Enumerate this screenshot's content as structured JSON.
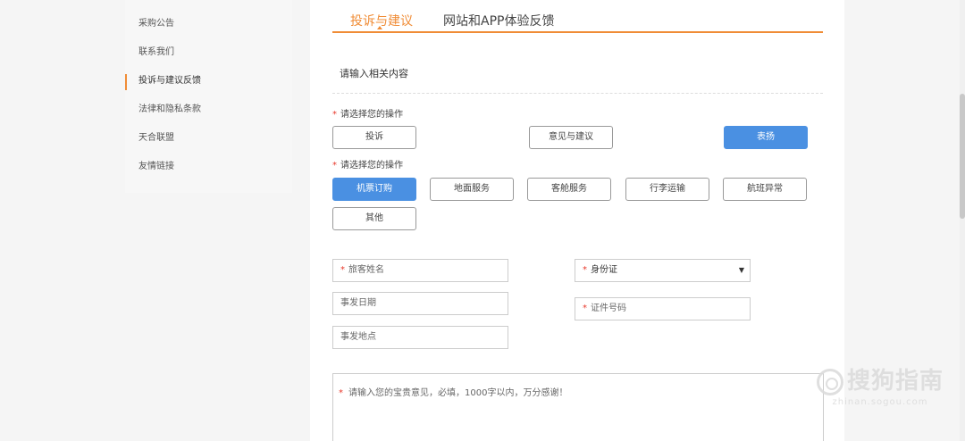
{
  "sidebar": {
    "items": [
      {
        "label": "采购公告"
      },
      {
        "label": "联系我们"
      },
      {
        "label": "投诉与建议反馈"
      },
      {
        "label": "法律和隐私条款"
      },
      {
        "label": "天合联盟"
      },
      {
        "label": "友情链接"
      }
    ],
    "active_index": 2
  },
  "tabs": [
    {
      "label": "投诉与建议"
    },
    {
      "label": "网站和APP体验反馈"
    }
  ],
  "form": {
    "section_title": "请输入相关内容",
    "required_mark": "*",
    "op_label_1": "请选择您的操作",
    "op_buttons_1": [
      {
        "label": "投诉"
      },
      {
        "label": "意见与建议"
      },
      {
        "label": "表扬"
      }
    ],
    "op_label_2": "请选择您的操作",
    "op_buttons_2": [
      {
        "label": "机票订购"
      },
      {
        "label": "地面服务"
      },
      {
        "label": "客舱服务"
      },
      {
        "label": "行李运输"
      },
      {
        "label": "航班异常"
      },
      {
        "label": "其他"
      }
    ],
    "passenger_name_placeholder": "旅客姓名",
    "id_type_selected": "身份证",
    "event_date_placeholder": "事发日期",
    "id_number_placeholder": "证件号码",
    "event_place_placeholder": "事发地点",
    "comment_placeholder": "请输入您的宝贵意见，必填，1000字以内，万分感谢！"
  },
  "watermark": {
    "logo_text": "搜狗指南",
    "url": "zhinan.sogou.com"
  },
  "colors": {
    "accent": "#f08c36",
    "selected_button": "#4a90e2",
    "required": "#e8382b"
  }
}
